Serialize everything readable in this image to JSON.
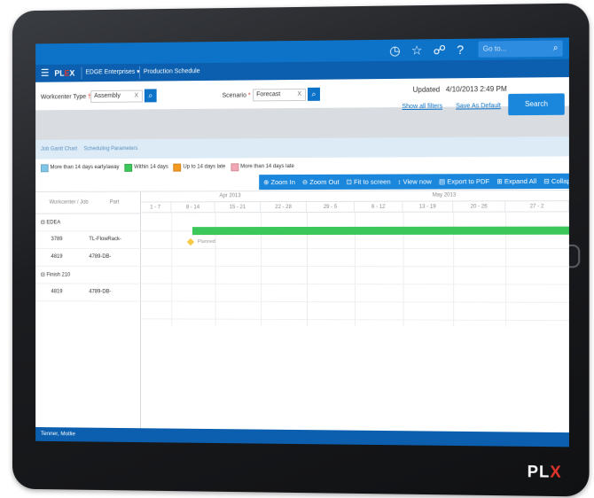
{
  "topbar": {
    "icons": [
      "clock-icon",
      "star-icon",
      "link-icon",
      "help-icon"
    ],
    "icon_glyphs": [
      "◷",
      "☆",
      "☍",
      "?"
    ],
    "search_placeholder": "Go to...",
    "accent": "#0d73c9"
  },
  "nav": {
    "menu_glyph": "☰",
    "logo_pre": "PL",
    "logo_post": "EX",
    "company": "EDGE Enterprises",
    "page": "Production Schedule"
  },
  "filters": {
    "workcenter_label": "Workcenter Type",
    "workcenter_value": "Assembly",
    "scenario_label": "Scenario",
    "scenario_value": "Forecast",
    "clear": "X",
    "updated_label": "Updated",
    "updated_value": "4/10/2013 2:49 PM"
  },
  "actions": {
    "show_all_filters": "Show all filters",
    "save_as_default": "Save As Default",
    "search": "Search"
  },
  "tabs": [
    "Job Gantt Chart",
    "Scheduling Parameters"
  ],
  "legend": [
    {
      "label": "More than 14 days early/away",
      "color": "#7fc6e8"
    },
    {
      "label": "Within 14 days",
      "color": "#3cc75a"
    },
    {
      "label": "Up to 14 days late",
      "color": "#f39a1f"
    },
    {
      "label": "More than 14 days late",
      "color": "#f2a7b3"
    }
  ],
  "toolbar": {
    "zoom_in": "Zoom In",
    "zoom_out": "Zoom Out",
    "fit": "Fit to screen",
    "view_now": "View now",
    "export_pdf": "Export to PDF",
    "expand_all": "Expand All",
    "collapse_all": "Collapse All"
  },
  "gantt": {
    "columns": [
      "Workcenter / Job",
      "Part"
    ],
    "months": [
      "Apr 2013",
      "May 2013"
    ],
    "weeks": [
      "1 - 7",
      "8 - 14",
      "15 - 21",
      "22 - 28",
      "29 - 5",
      "6 - 12",
      "13 - 19",
      "20 - 26",
      "27 - 2"
    ],
    "rows": [
      {
        "job": "⊟ EDEA",
        "part": ""
      },
      {
        "job": "3789",
        "part": "TL-FlowRack-"
      },
      {
        "job": "4819",
        "part": "4789-DB-"
      },
      {
        "job": "⊟ Finish 210",
        "part": ""
      },
      {
        "job": "4819",
        "part": "4789-DB-"
      }
    ],
    "planned_label": "Planned"
  },
  "footer": {
    "user": "Tenner, Mollie"
  },
  "device_logo_pre": "PL",
  "device_logo_post": "EX"
}
